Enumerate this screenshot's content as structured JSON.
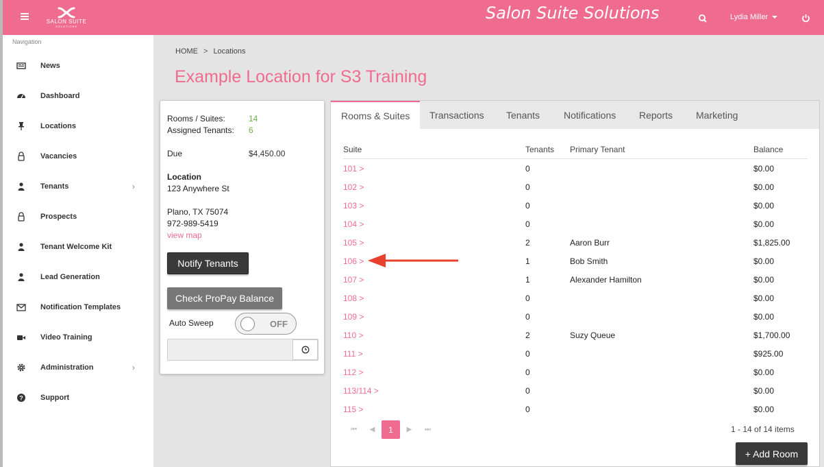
{
  "header": {
    "title": "Salon Suite Solutions",
    "logo_text": "SALON SUITE",
    "logo_sub": "SOLUTIONS",
    "user_name": "Lydia Miller",
    "brand_color": "#f06b90"
  },
  "sidebar": {
    "label": "Navigation",
    "items": [
      {
        "label": "News",
        "icon": "newspaper-icon"
      },
      {
        "label": "Dashboard",
        "icon": "dashboard-icon"
      },
      {
        "label": "Locations",
        "icon": "pin-icon"
      },
      {
        "label": "Vacancies",
        "icon": "lock-icon"
      },
      {
        "label": "Tenants",
        "icon": "user-icon",
        "has_children": true
      },
      {
        "label": "Prospects",
        "icon": "lock-icon"
      },
      {
        "label": "Tenant Welcome Kit",
        "icon": "user-icon"
      },
      {
        "label": "Lead Generation",
        "icon": "user-icon"
      },
      {
        "label": "Notification Templates",
        "icon": "envelope-icon"
      },
      {
        "label": "Video Training",
        "icon": "video-icon"
      },
      {
        "label": "Administration",
        "icon": "gear-icon",
        "has_children": true
      },
      {
        "label": "Support",
        "icon": "question-icon"
      }
    ]
  },
  "breadcrumb": {
    "home": "HOME",
    "separator": ">",
    "current": "Locations"
  },
  "page_title": "Example Location for S3 Training",
  "info": {
    "rooms_label": "Rooms / Suites:",
    "rooms_value": "14",
    "tenants_label": "Assigned Tenants:",
    "tenants_value": "6",
    "due_label": "Due",
    "due_value": "$4,450.00",
    "location_label": "Location",
    "address1": "123 Anywhere St",
    "address2": "Plano, TX 75074",
    "phone": "972-989-5419",
    "map_link": "view map",
    "notify_button": "Notify Tenants",
    "propay_button": "Check ProPay Balance",
    "auto_sweep_label": "Auto Sweep",
    "auto_sweep_state": "OFF",
    "time_value": ""
  },
  "tabs": [
    {
      "label": "Rooms & Suites",
      "active": true
    },
    {
      "label": "Transactions",
      "active": false
    },
    {
      "label": "Tenants",
      "active": false
    },
    {
      "label": "Notifications",
      "active": false
    },
    {
      "label": "Reports",
      "active": false
    },
    {
      "label": "Marketing",
      "active": false
    }
  ],
  "table": {
    "columns": [
      "Suite",
      "Tenants",
      "Primary Tenant",
      "Balance"
    ],
    "rows": [
      {
        "suite": "101 >",
        "tenants": "0",
        "primary": "",
        "balance": "$0.00"
      },
      {
        "suite": "102 >",
        "tenants": "0",
        "primary": "",
        "balance": "$0.00"
      },
      {
        "suite": "103 >",
        "tenants": "0",
        "primary": "",
        "balance": "$0.00"
      },
      {
        "suite": "104 >",
        "tenants": "0",
        "primary": "",
        "balance": "$0.00"
      },
      {
        "suite": "105 >",
        "tenants": "2",
        "primary": "Aaron Burr",
        "balance": "$1,825.00"
      },
      {
        "suite": "106 >",
        "tenants": "1",
        "primary": "Bob Smith",
        "balance": "$0.00"
      },
      {
        "suite": "107 >",
        "tenants": "1",
        "primary": "Alexander Hamilton",
        "balance": "$0.00"
      },
      {
        "suite": "108 >",
        "tenants": "0",
        "primary": "",
        "balance": "$0.00"
      },
      {
        "suite": "109 >",
        "tenants": "0",
        "primary": "",
        "balance": "$0.00"
      },
      {
        "suite": "110 >",
        "tenants": "2",
        "primary": "Suzy Queue",
        "balance": "$1,700.00"
      },
      {
        "suite": "111 >",
        "tenants": "0",
        "primary": "",
        "balance": "$925.00"
      },
      {
        "suite": "112 >",
        "tenants": "0",
        "primary": "",
        "balance": "$0.00"
      },
      {
        "suite": "113/114 >",
        "tenants": "0",
        "primary": "",
        "balance": "$0.00"
      },
      {
        "suite": "115 >",
        "tenants": "0",
        "primary": "",
        "balance": "$0.00"
      }
    ]
  },
  "pager": {
    "current_page": "1",
    "info": "1 - 14 of 14 items"
  },
  "add_room_button": "+ Add Room",
  "annotation_color": "#e8402f"
}
